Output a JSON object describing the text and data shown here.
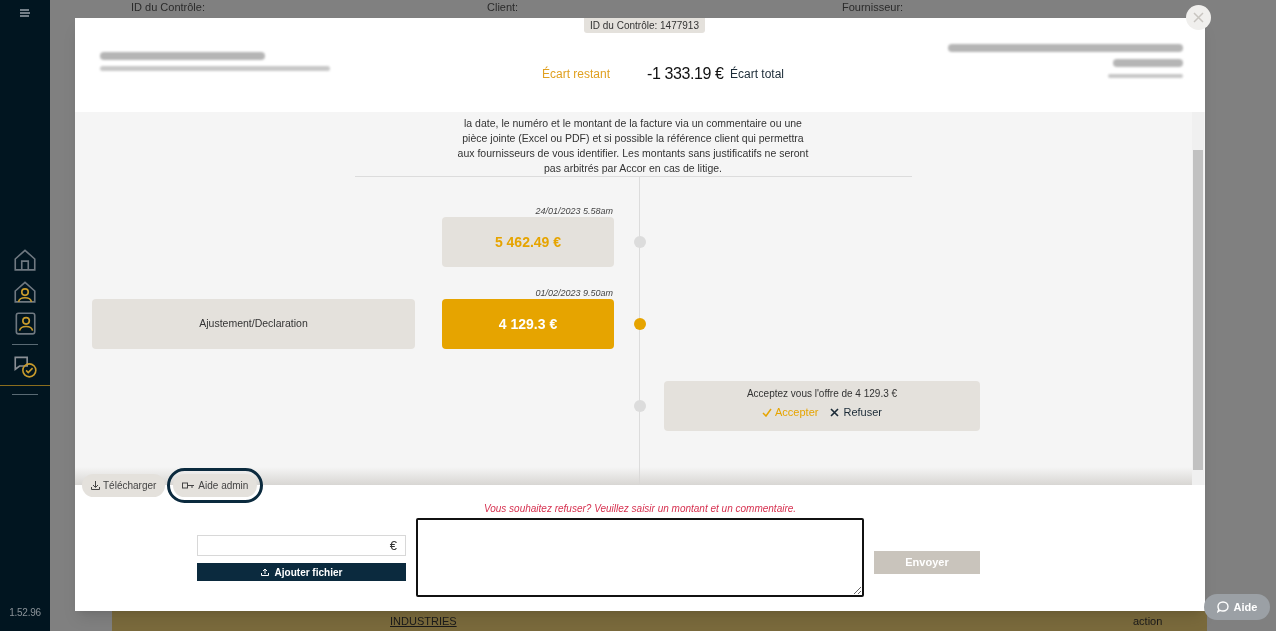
{
  "background": {
    "filter_labels": [
      "ID du Contrôle:",
      "Client:",
      "Fournisseur:"
    ],
    "row_cells": [
      "INDUSTRIES",
      "action"
    ]
  },
  "sidebar": {
    "items": [
      {
        "kind": "home",
        "selected": false
      },
      {
        "kind": "profile",
        "selected": false
      },
      {
        "kind": "contacts",
        "selected": false
      },
      {
        "kind": "disputes",
        "selected": true
      }
    ],
    "version": "1.52.96"
  },
  "modal": {
    "id_badge": "ID du Contrôle: 1477913",
    "remaining_label": "Écart restant",
    "total_amount": "-1 333.19 €",
    "total_label": "Écart total",
    "notice": "la date, le numéro et le montant de la facture via un commentaire ou une pièce jointe (Excel ou PDF) et si possible la référence client qui permettra aux fournisseurs de vous identifier. Les montants sans justificatifs ne seront pas arbitrés par Accor en cas de litige.",
    "timeline": [
      {
        "date": "24/01/2023 5.58am",
        "amount": "5 462.49 €",
        "selected": false
      },
      {
        "date": "01/02/2023 9.50am",
        "amount": "4 129.3 €",
        "selected": true,
        "side_label": "Ajustement/Declaration"
      }
    ],
    "offer": {
      "question": "Acceptez vous l'offre de 4 129.3 €",
      "accept": "Accepter",
      "refuse": "Refuser"
    },
    "tabs": [
      {
        "label": "Télécharger",
        "highlighted": false
      },
      {
        "label": "Aide admin",
        "highlighted": true
      }
    ],
    "refuse_prompt": "Vous souhaitez refuser? Veuillez saisir un montant et un commentaire.",
    "amount_suffix": "€",
    "upload_button": "Ajouter fichier",
    "send_button": "Envoyer"
  },
  "help_button": "Aide"
}
